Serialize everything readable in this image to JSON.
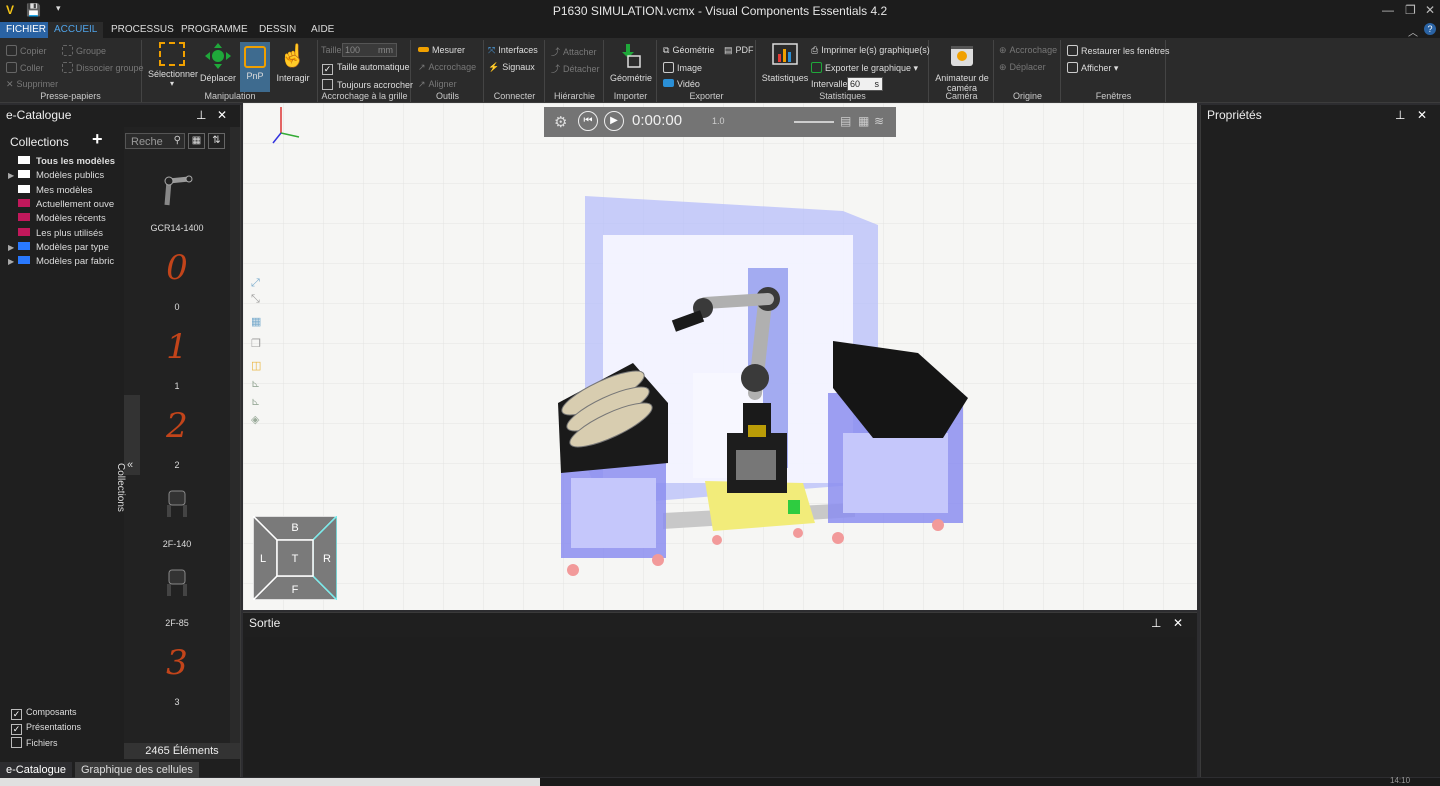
{
  "window": {
    "title": "P1630 SIMULATION.vcmx - Visual Components Essentials 4.2"
  },
  "menu": {
    "tabs": [
      "FICHIER",
      "ACCUEIL",
      "PROCESSUS",
      "PROGRAMME",
      "DESSIN",
      "AIDE"
    ],
    "active": "ACCUEIL"
  },
  "ribbon": {
    "clipboard": {
      "copy": "Copier",
      "paste": "Coller",
      "delete": "Supprimer",
      "group": "Groupe",
      "ungroup": "Dissocier groupe",
      "label": "Presse-papiers"
    },
    "manipulation": {
      "select": "Sélectionner",
      "move": "Déplacer",
      "pnp": "PnP",
      "interact": "Interagir",
      "label": "Manipulation"
    },
    "grid": {
      "size_label": "Taille",
      "size_value": "100",
      "size_unit": "mm",
      "auto_size": "Taille automatique",
      "always_snap": "Toujours accrocher",
      "label": "Accrochage à la grille"
    },
    "tools": {
      "measure": "Mesurer",
      "snap": "Accrochage",
      "align": "Aligner",
      "label": "Outils"
    },
    "connect": {
      "interfaces": "Interfaces",
      "signals": "Signaux",
      "label": "Connecter"
    },
    "hierarchy": {
      "attach": "Attacher",
      "detach": "Détacher",
      "label": "Hiérarchie"
    },
    "import": {
      "geometry": "Géométrie",
      "label": "Importer"
    },
    "export": {
      "geometry": "Géométrie",
      "pdf": "PDF",
      "image": "Image",
      "video": "Vidéo",
      "label": "Exporter"
    },
    "stats": {
      "stats": "Statistiques",
      "print": "Imprimer le(s) graphique(s)",
      "export_chart": "Exporter le graphique ▾",
      "interval_label": "Intervalle",
      "interval_value": "60",
      "interval_unit": "s",
      "label": "Statistiques"
    },
    "camera": {
      "animator_line1": "Animateur de",
      "animator_line2": "caméra",
      "label": "Caméra"
    },
    "origin": {
      "snap": "Accrochage",
      "move": "Déplacer",
      "label": "Origine"
    },
    "windows": {
      "restore": "Restaurer les fenêtres",
      "show": "Afficher ▾",
      "label": "Fenêtres"
    }
  },
  "catalog": {
    "title": "e-Catalogue",
    "collections_label": "Collections",
    "search_placeholder": "Reche",
    "tree": [
      {
        "label": "Tous les modèles",
        "bold": true,
        "arrow": false,
        "color": "#ffffff"
      },
      {
        "label": "Modèles publics",
        "bold": false,
        "arrow": true,
        "color": "#ffffff"
      },
      {
        "label": "Mes modèles",
        "bold": false,
        "arrow": false,
        "color": "#ffffff"
      },
      {
        "label": "Actuellement ouve",
        "bold": false,
        "arrow": false,
        "color": "#c2185b"
      },
      {
        "label": "Modèles récents",
        "bold": false,
        "arrow": false,
        "color": "#c2185b"
      },
      {
        "label": "Les plus utilisés",
        "bold": false,
        "arrow": false,
        "color": "#c2185b"
      },
      {
        "label": "Modèles par type",
        "bold": false,
        "arrow": true,
        "color": "#2979ff"
      },
      {
        "label": "Modèles par fabric",
        "bold": false,
        "arrow": true,
        "color": "#2979ff"
      }
    ],
    "models": [
      {
        "name": "GCR14-1400",
        "kind": "robot"
      },
      {
        "name": "0",
        "kind": "digit"
      },
      {
        "name": "1",
        "kind": "digit"
      },
      {
        "name": "2",
        "kind": "digit"
      },
      {
        "name": "2F-140",
        "kind": "gripper"
      },
      {
        "name": "2F-85",
        "kind": "gripper"
      },
      {
        "name": "3",
        "kind": "digit"
      }
    ],
    "vertical_tab": "Collections",
    "filters": [
      {
        "label": "Composants",
        "checked": true
      },
      {
        "label": "Présentations",
        "checked": true
      },
      {
        "label": "Fichiers",
        "checked": false
      }
    ],
    "count": "2465 Éléments",
    "bottom_tabs": [
      "e-Catalogue",
      "Graphique des cellules"
    ]
  },
  "viewport": {
    "time": "0:00:00",
    "speed": "1.0",
    "navcube": {
      "top": "B",
      "left": "L",
      "center": "T",
      "right": "R",
      "bottom": "F"
    }
  },
  "output": {
    "title": "Sortie"
  },
  "properties": {
    "title": "Propriétés"
  },
  "status": {
    "right_text": "14:10"
  }
}
